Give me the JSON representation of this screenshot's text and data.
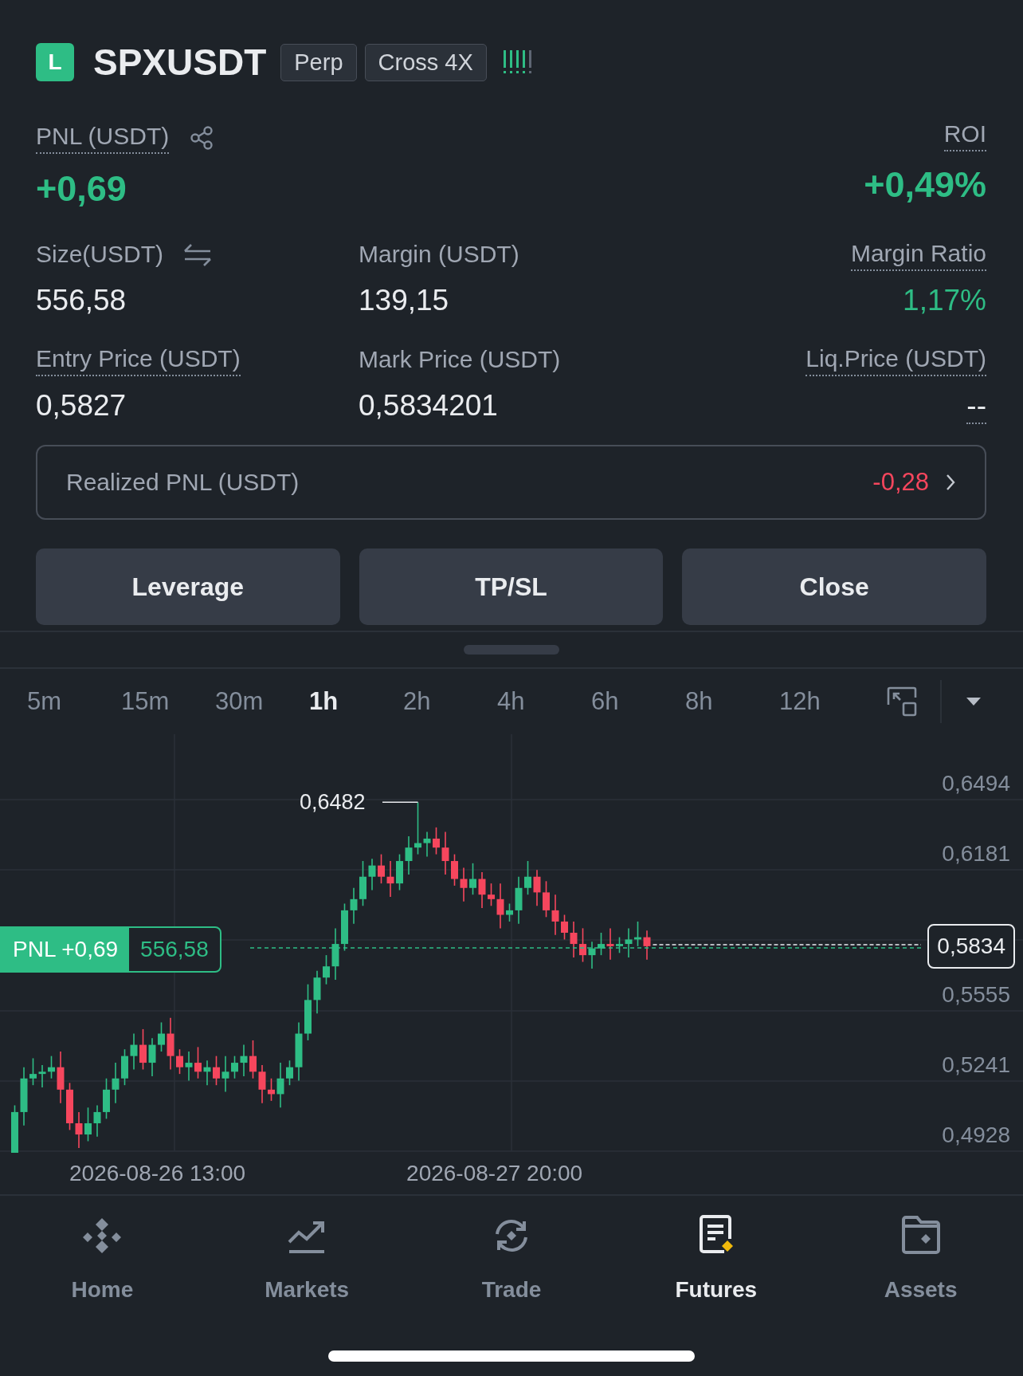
{
  "header": {
    "badge": "L",
    "symbol": "SPXUSDT",
    "tags": [
      "Perp",
      "Cross 4X"
    ]
  },
  "pnl": {
    "label": "PNL (USDT)",
    "value": "+0,69"
  },
  "roi": {
    "label": "ROI",
    "value": "+0,49%"
  },
  "stats": [
    [
      {
        "label": "Size(USDT)",
        "value": "556,58",
        "underlined": false,
        "kind": "convert",
        "color": "#eaecef"
      },
      {
        "label": "Margin (USDT)",
        "value": "139,15",
        "underlined": false,
        "kind": "plain",
        "color": "#eaecef"
      },
      {
        "label": "Margin Ratio",
        "value": "1,17%",
        "underlined": true,
        "kind": "plain",
        "color": "#2ebd85"
      }
    ],
    [
      {
        "label": "Entry Price (USDT)",
        "value": "0,5827",
        "underlined": true,
        "kind": "plain",
        "color": "#eaecef"
      },
      {
        "label": "Mark Price (USDT)",
        "value": "0,5834201",
        "underlined": false,
        "kind": "plain",
        "color": "#eaecef"
      },
      {
        "label": "Liq.Price (USDT)",
        "value": "--",
        "underlined": true,
        "kind": "dashed",
        "color": "#eaecef"
      }
    ]
  ],
  "realized": {
    "label": "Realized PNL (USDT)",
    "value": "-0,28",
    "color": "#f6465d"
  },
  "actions": [
    "Leverage",
    "TP/SL",
    "Close"
  ],
  "timeframes": [
    {
      "label": "5m",
      "selected": false
    },
    {
      "label": "15m",
      "selected": false
    },
    {
      "label": "30m",
      "selected": false
    },
    {
      "label": "1h",
      "selected": true
    },
    {
      "label": "2h",
      "selected": false
    },
    {
      "label": "4h",
      "selected": false
    },
    {
      "label": "6h",
      "selected": false
    },
    {
      "label": "8h",
      "selected": false
    },
    {
      "label": "12h",
      "selected": false
    }
  ],
  "chart": {
    "y_labels": [
      "0,6494",
      "0,6181",
      "0,5555",
      "0,5241",
      "0,4928"
    ],
    "x_labels": [
      "2026-08-26 13:00",
      "2026-08-27 20:00"
    ],
    "high_label": "0,6482",
    "position_tag": {
      "pnl": "PNL +0,69",
      "size": "556,58"
    },
    "price_tag": "0,5834"
  },
  "nav": [
    {
      "label": "Home",
      "selected": false
    },
    {
      "label": "Markets",
      "selected": false
    },
    {
      "label": "Trade",
      "selected": false
    },
    {
      "label": "Futures",
      "selected": true
    },
    {
      "label": "Assets",
      "selected": false
    }
  ]
}
